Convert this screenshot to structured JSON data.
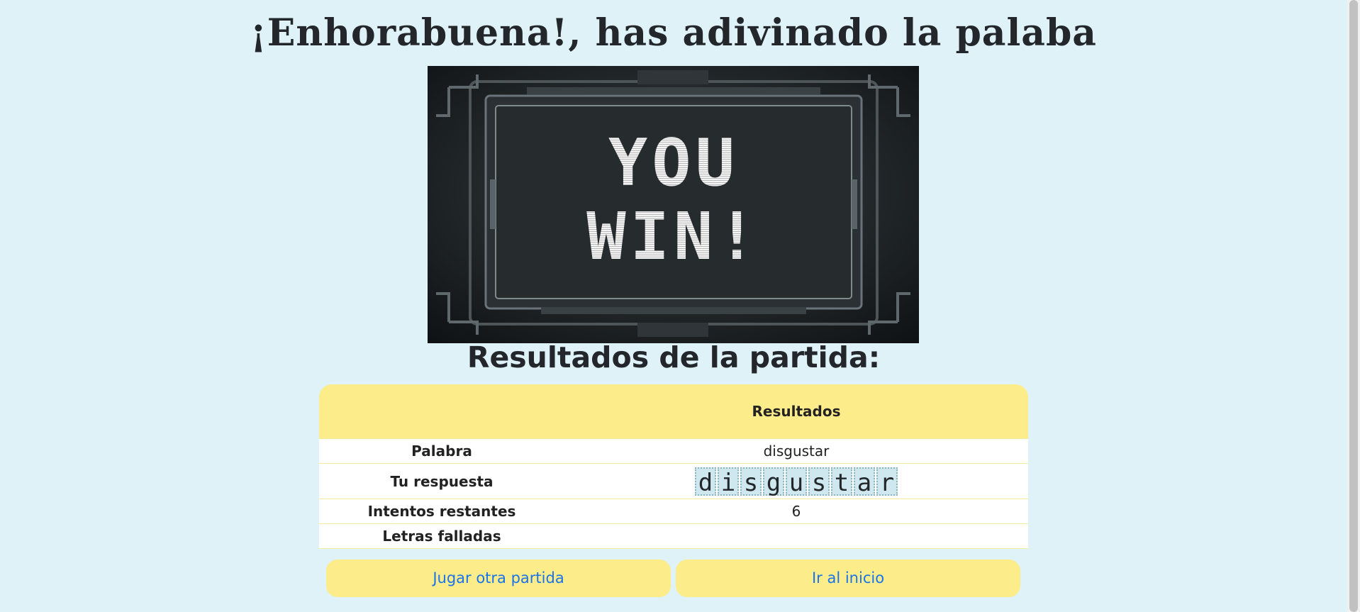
{
  "header": {
    "title": "¡Enhorabuena!, has adivinado la palaba"
  },
  "hero": {
    "line1": "YOU",
    "line2": "WIN!"
  },
  "results": {
    "subtitle": "Resultados de la partida:",
    "column_header": "Resultados",
    "rows": [
      {
        "label": "Palabra",
        "value": "disgustar"
      },
      {
        "label": "Tu respuesta",
        "letters": [
          "d",
          "i",
          "s",
          "g",
          "u",
          "s",
          "t",
          "a",
          "r"
        ]
      },
      {
        "label": "Intentos restantes",
        "value": "6"
      },
      {
        "label": "Letras falladas",
        "value": ""
      }
    ]
  },
  "actions": {
    "play_again": "Jugar otra partida",
    "home": "Ir al inicio"
  },
  "colors": {
    "background": "#def2f7",
    "accent_yellow": "#fdec8a",
    "link_blue": "#1a73e8"
  }
}
